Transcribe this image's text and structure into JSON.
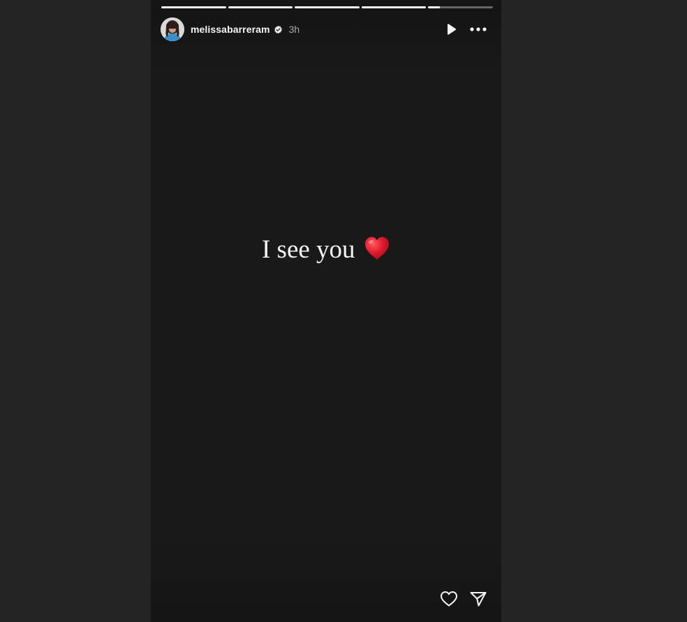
{
  "story": {
    "username": "melissabarreram",
    "time_ago": "3h",
    "caption": "I see you",
    "caption_emoji": "red-heart-emoji",
    "progress": [
      1,
      1,
      1,
      1,
      0.18
    ]
  },
  "icons": {
    "verified": "verified-badge-icon",
    "play": "play-icon",
    "more": "more-options-icon",
    "like": "heart-outline-icon",
    "share": "send-icon"
  },
  "colors": {
    "background": "#242424",
    "story_background": "#191919",
    "text": "#f5f5f5",
    "muted_text": "#a8a8a8",
    "heart": "#e0182d"
  }
}
